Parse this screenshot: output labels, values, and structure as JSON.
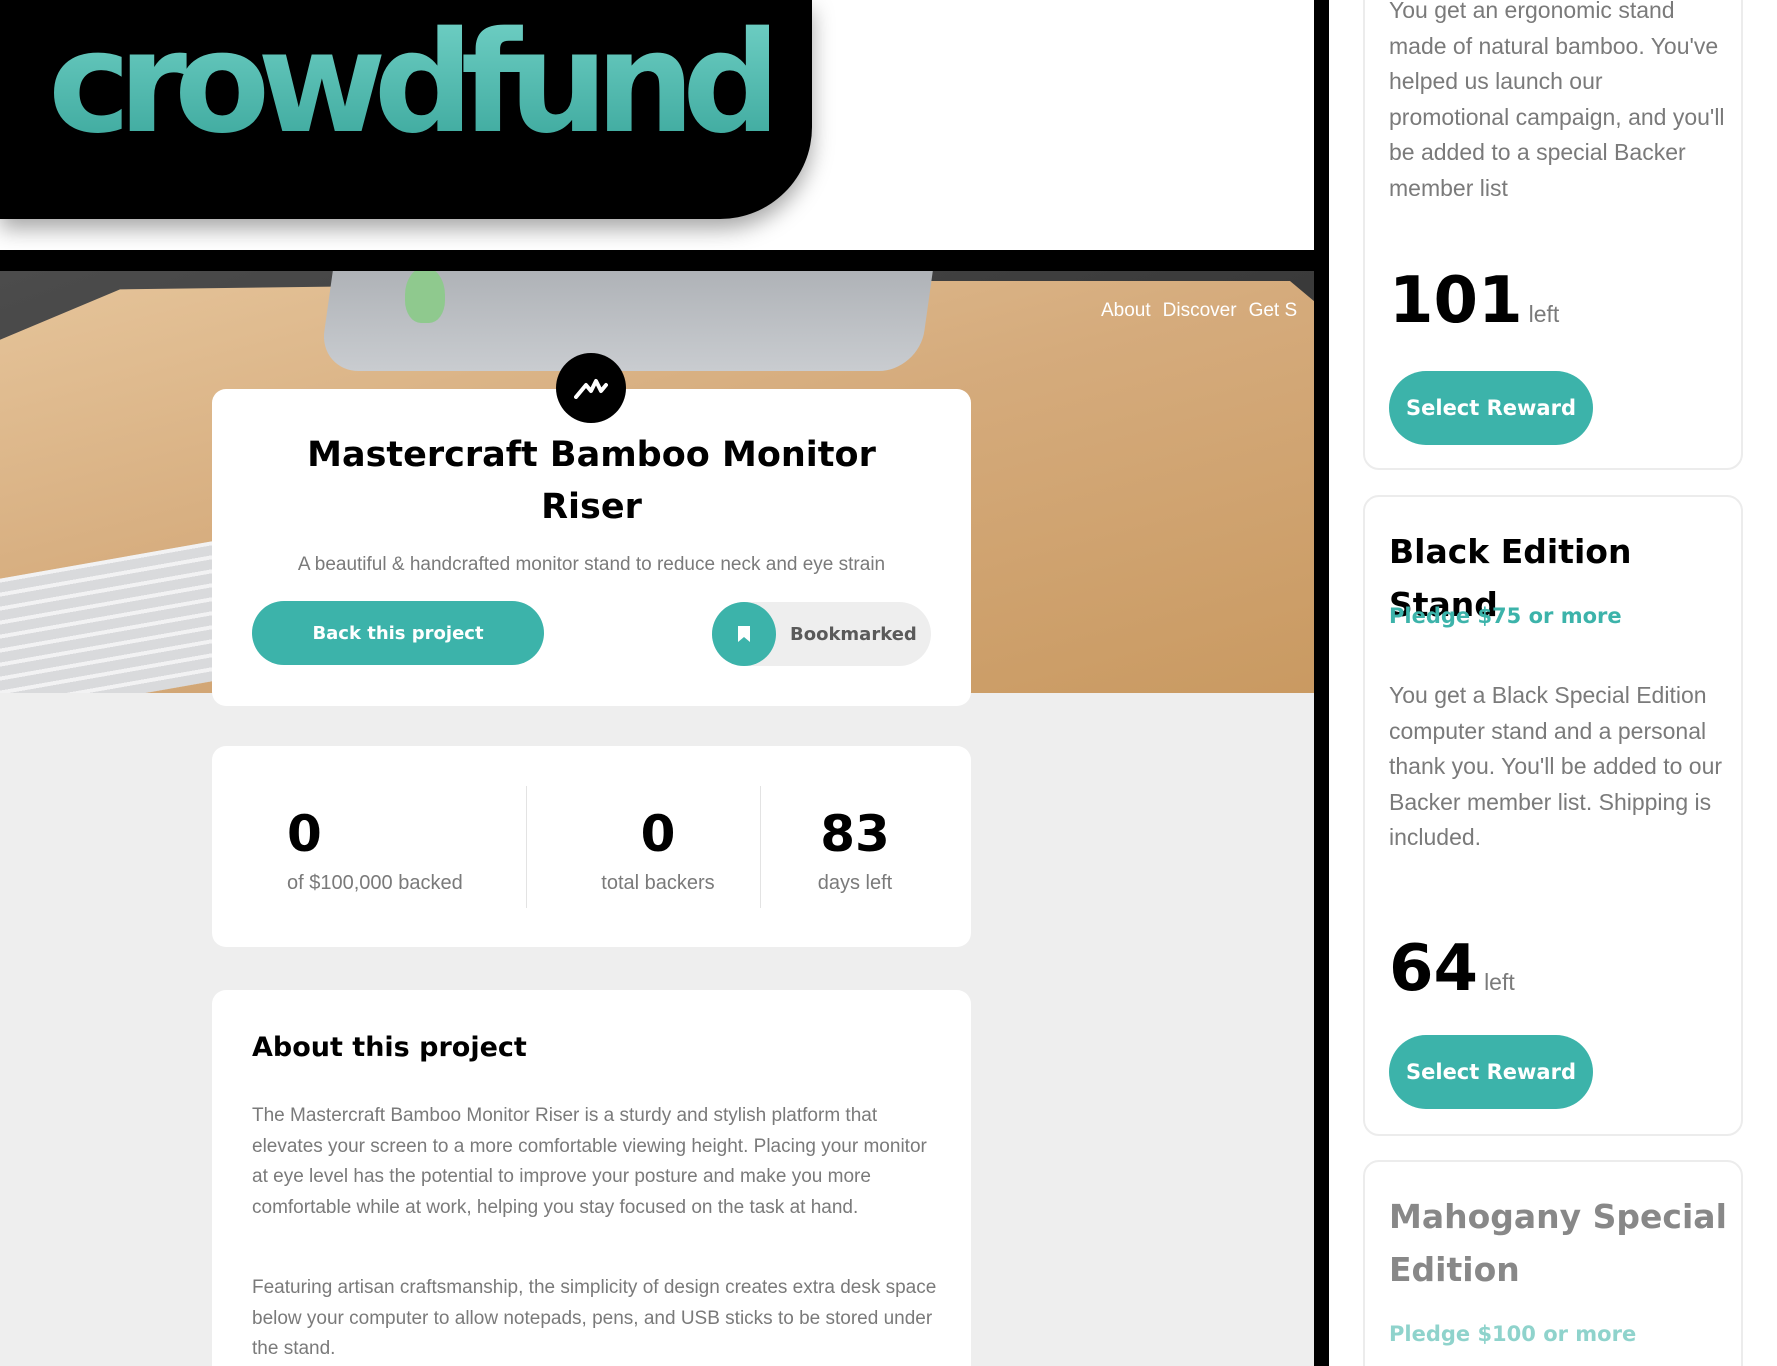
{
  "brand": {
    "logo_text": "crowdfund"
  },
  "nav": {
    "items": [
      "About",
      "Discover",
      "Get S"
    ]
  },
  "project": {
    "title": "Mastercraft Bamboo Monitor Riser",
    "description": "A beautiful & handcrafted monitor stand to reduce neck and eye strain",
    "back_label": "Back this project",
    "bookmark_label": "Bookmarked"
  },
  "stats": [
    {
      "value": "0",
      "label": "of $100,000 backed"
    },
    {
      "value": "0",
      "label": "total backers"
    },
    {
      "value": "83",
      "label": "days left"
    }
  ],
  "about": {
    "title": "About this project",
    "paragraphs": [
      "The Mastercraft Bamboo Monitor Riser is a sturdy and stylish platform that elevates your screen to a more comfortable viewing height. Placing your monitor at eye level has the potential to improve your posture and make you more comfortable while at work, helping you stay focused on the task at hand.",
      "Featuring artisan craftsmanship, the simplicity of design creates extra desk space below your computer to allow notepads, pens, and USB sticks to be stored under the stand."
    ]
  },
  "rewards": [
    {
      "description": "You get an ergonomic stand made of natural bamboo. You've helped us launch our promotional campaign, and you'll be added to a special Backer member list",
      "count": "101",
      "count_suffix": "left",
      "button": "Select Reward"
    },
    {
      "title": "Black Edition Stand",
      "pledge": "Pledge $75 or more",
      "description": "You get a Black Special Edition computer stand and a personal thank you. You'll be added to our Backer member list. Shipping is included.",
      "count": "64",
      "count_suffix": "left",
      "button": "Select Reward"
    },
    {
      "title": "Mahogany Special Edition",
      "pledge": "Pledge $100 or more"
    }
  ],
  "colors": {
    "accent": "#3cb3aa",
    "accent_light": "#8fd3cc",
    "logo_gradient_top": "#6fcfc4",
    "logo_gradient_bottom": "#3ba79c"
  },
  "icons": {
    "project_logo": "mastercraft-logo-icon",
    "bookmark": "bookmark-icon"
  }
}
